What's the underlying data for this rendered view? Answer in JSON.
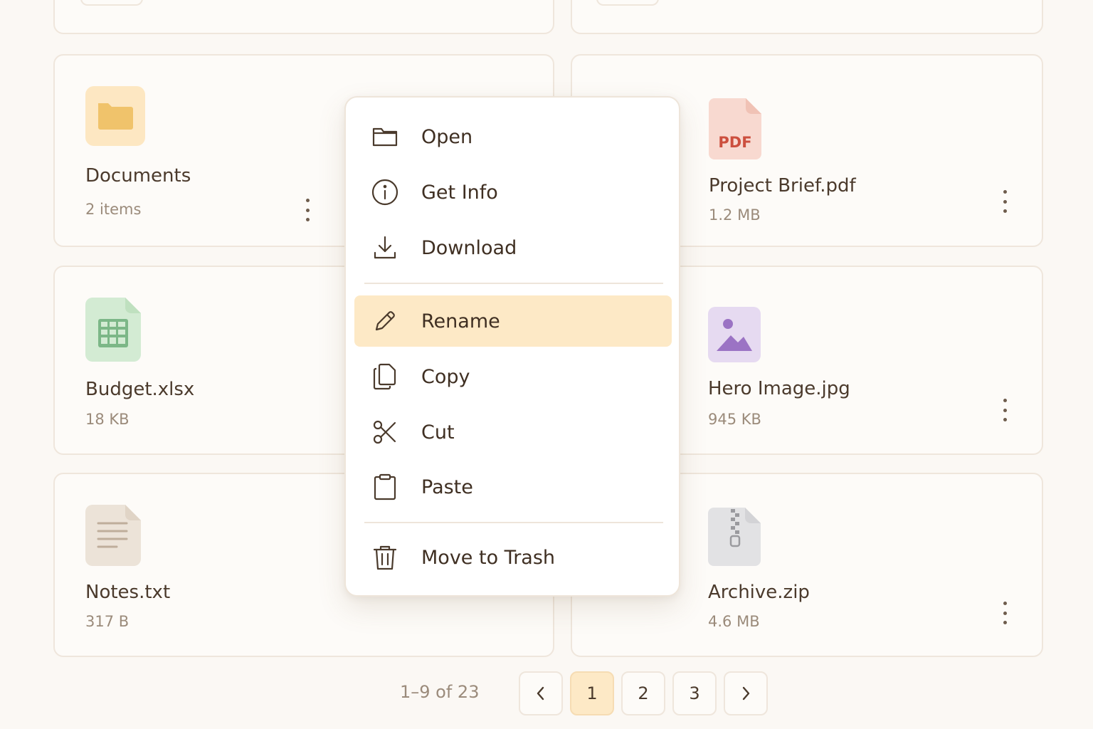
{
  "files": {
    "documents": {
      "name": "Documents",
      "meta": "2 items",
      "icon": "folder-icon"
    },
    "project_brief": {
      "name": "Project Brief.pdf",
      "meta": "1.2 MB",
      "icon": "pdf-file-icon",
      "badge": "PDF"
    },
    "budget": {
      "name": "Budget.xlsx",
      "meta": "18 KB",
      "icon": "spreadsheet-file-icon"
    },
    "hero_image": {
      "name": "Hero Image.jpg",
      "meta": "945 KB",
      "icon": "image-file-icon"
    },
    "notes": {
      "name": "Notes.txt",
      "meta": "317 B",
      "icon": "text-file-icon"
    },
    "archive": {
      "name": "Archive.zip",
      "meta": "4.6 MB",
      "icon": "zip-file-icon"
    }
  },
  "context_menu": {
    "items": [
      {
        "label": "Open",
        "icon": "folder-icon"
      },
      {
        "label": "Get Info",
        "icon": "info-icon"
      },
      {
        "label": "Download",
        "icon": "download-icon"
      },
      {
        "label": "Rename",
        "icon": "pencil-icon",
        "highlighted": true
      },
      {
        "label": "Copy",
        "icon": "copy-icon"
      },
      {
        "label": "Cut",
        "icon": "scissors-icon"
      },
      {
        "label": "Paste",
        "icon": "clipboard-icon"
      },
      {
        "label": "Move to Trash",
        "icon": "trash-icon"
      }
    ]
  },
  "pagination": {
    "range": "1–9 of 23",
    "pages": [
      "1",
      "2",
      "3"
    ],
    "current": "1"
  },
  "colors": {
    "background": "#fbf8f4",
    "highlight": "#fde9c6",
    "folder": "#f0c36b",
    "pdf": "#cc4f3e",
    "spreadsheet": "#7cb787",
    "image": "#9b73c4",
    "text": "#4a3a2c",
    "muted": "#9b8b7b"
  }
}
